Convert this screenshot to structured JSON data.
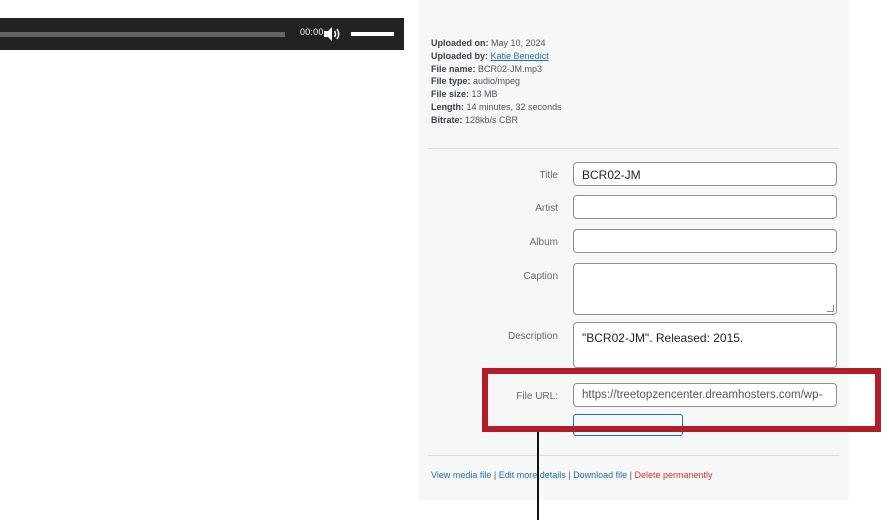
{
  "player": {
    "time": "00:00",
    "progress": 0,
    "volume": 1,
    "icons": {
      "volume": "speaker-icon"
    }
  },
  "attachment": {
    "uploaded_on_label": "Uploaded on:",
    "uploaded_on": "May 10, 2024",
    "uploaded_by_label": "Uploaded by:",
    "uploaded_by": "Katie Benedict",
    "file_name_label": "File name:",
    "file_name": "BCR02-JM.mp3",
    "file_type_label": "File type:",
    "file_type": "audio/mpeg",
    "file_size_label": "File size:",
    "file_size": "13 MB",
    "length_label": "Length:",
    "length": "14 minutes, 32 seconds",
    "bitrate_label": "Bitrate:",
    "bitrate": "128kb/s CBR"
  },
  "form": {
    "title_label": "Title",
    "title_value": "BCR02-JM",
    "artist_label": "Artist",
    "artist_value": "",
    "album_label": "Album",
    "album_value": "",
    "caption_label": "Caption",
    "caption_value": "",
    "description_label": "Description",
    "description_value": "\"BCR02-JM\". Released: 2015.",
    "file_url_label": "File URL:",
    "file_url_value": "https://treetopzencenter.dreamhosters.com/wp-"
  },
  "actions": {
    "view": "View media file",
    "edit": "Edit more details",
    "download": "Download file",
    "delete": "Delete permanently",
    "separator": " | "
  },
  "colors": {
    "link": "#2271b1",
    "delete": "#d63638",
    "highlight": "#b01e2b",
    "player_bg": "#222222"
  }
}
